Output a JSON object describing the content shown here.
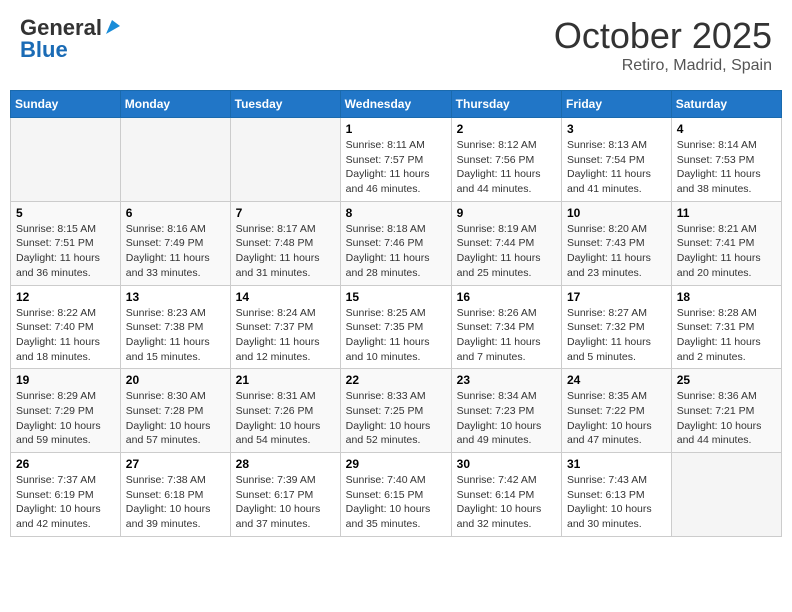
{
  "header": {
    "logo_general": "General",
    "logo_blue": "Blue",
    "title": "October 2025",
    "subtitle": "Retiro, Madrid, Spain"
  },
  "weekdays": [
    "Sunday",
    "Monday",
    "Tuesday",
    "Wednesday",
    "Thursday",
    "Friday",
    "Saturday"
  ],
  "weeks": [
    [
      {
        "day": "",
        "info": ""
      },
      {
        "day": "",
        "info": ""
      },
      {
        "day": "",
        "info": ""
      },
      {
        "day": "1",
        "info": "Sunrise: 8:11 AM\nSunset: 7:57 PM\nDaylight: 11 hours and 46 minutes."
      },
      {
        "day": "2",
        "info": "Sunrise: 8:12 AM\nSunset: 7:56 PM\nDaylight: 11 hours and 44 minutes."
      },
      {
        "day": "3",
        "info": "Sunrise: 8:13 AM\nSunset: 7:54 PM\nDaylight: 11 hours and 41 minutes."
      },
      {
        "day": "4",
        "info": "Sunrise: 8:14 AM\nSunset: 7:53 PM\nDaylight: 11 hours and 38 minutes."
      }
    ],
    [
      {
        "day": "5",
        "info": "Sunrise: 8:15 AM\nSunset: 7:51 PM\nDaylight: 11 hours and 36 minutes."
      },
      {
        "day": "6",
        "info": "Sunrise: 8:16 AM\nSunset: 7:49 PM\nDaylight: 11 hours and 33 minutes."
      },
      {
        "day": "7",
        "info": "Sunrise: 8:17 AM\nSunset: 7:48 PM\nDaylight: 11 hours and 31 minutes."
      },
      {
        "day": "8",
        "info": "Sunrise: 8:18 AM\nSunset: 7:46 PM\nDaylight: 11 hours and 28 minutes."
      },
      {
        "day": "9",
        "info": "Sunrise: 8:19 AM\nSunset: 7:44 PM\nDaylight: 11 hours and 25 minutes."
      },
      {
        "day": "10",
        "info": "Sunrise: 8:20 AM\nSunset: 7:43 PM\nDaylight: 11 hours and 23 minutes."
      },
      {
        "day": "11",
        "info": "Sunrise: 8:21 AM\nSunset: 7:41 PM\nDaylight: 11 hours and 20 minutes."
      }
    ],
    [
      {
        "day": "12",
        "info": "Sunrise: 8:22 AM\nSunset: 7:40 PM\nDaylight: 11 hours and 18 minutes."
      },
      {
        "day": "13",
        "info": "Sunrise: 8:23 AM\nSunset: 7:38 PM\nDaylight: 11 hours and 15 minutes."
      },
      {
        "day": "14",
        "info": "Sunrise: 8:24 AM\nSunset: 7:37 PM\nDaylight: 11 hours and 12 minutes."
      },
      {
        "day": "15",
        "info": "Sunrise: 8:25 AM\nSunset: 7:35 PM\nDaylight: 11 hours and 10 minutes."
      },
      {
        "day": "16",
        "info": "Sunrise: 8:26 AM\nSunset: 7:34 PM\nDaylight: 11 hours and 7 minutes."
      },
      {
        "day": "17",
        "info": "Sunrise: 8:27 AM\nSunset: 7:32 PM\nDaylight: 11 hours and 5 minutes."
      },
      {
        "day": "18",
        "info": "Sunrise: 8:28 AM\nSunset: 7:31 PM\nDaylight: 11 hours and 2 minutes."
      }
    ],
    [
      {
        "day": "19",
        "info": "Sunrise: 8:29 AM\nSunset: 7:29 PM\nDaylight: 10 hours and 59 minutes."
      },
      {
        "day": "20",
        "info": "Sunrise: 8:30 AM\nSunset: 7:28 PM\nDaylight: 10 hours and 57 minutes."
      },
      {
        "day": "21",
        "info": "Sunrise: 8:31 AM\nSunset: 7:26 PM\nDaylight: 10 hours and 54 minutes."
      },
      {
        "day": "22",
        "info": "Sunrise: 8:33 AM\nSunset: 7:25 PM\nDaylight: 10 hours and 52 minutes."
      },
      {
        "day": "23",
        "info": "Sunrise: 8:34 AM\nSunset: 7:23 PM\nDaylight: 10 hours and 49 minutes."
      },
      {
        "day": "24",
        "info": "Sunrise: 8:35 AM\nSunset: 7:22 PM\nDaylight: 10 hours and 47 minutes."
      },
      {
        "day": "25",
        "info": "Sunrise: 8:36 AM\nSunset: 7:21 PM\nDaylight: 10 hours and 44 minutes."
      }
    ],
    [
      {
        "day": "26",
        "info": "Sunrise: 7:37 AM\nSunset: 6:19 PM\nDaylight: 10 hours and 42 minutes."
      },
      {
        "day": "27",
        "info": "Sunrise: 7:38 AM\nSunset: 6:18 PM\nDaylight: 10 hours and 39 minutes."
      },
      {
        "day": "28",
        "info": "Sunrise: 7:39 AM\nSunset: 6:17 PM\nDaylight: 10 hours and 37 minutes."
      },
      {
        "day": "29",
        "info": "Sunrise: 7:40 AM\nSunset: 6:15 PM\nDaylight: 10 hours and 35 minutes."
      },
      {
        "day": "30",
        "info": "Sunrise: 7:42 AM\nSunset: 6:14 PM\nDaylight: 10 hours and 32 minutes."
      },
      {
        "day": "31",
        "info": "Sunrise: 7:43 AM\nSunset: 6:13 PM\nDaylight: 10 hours and 30 minutes."
      },
      {
        "day": "",
        "info": ""
      }
    ]
  ]
}
